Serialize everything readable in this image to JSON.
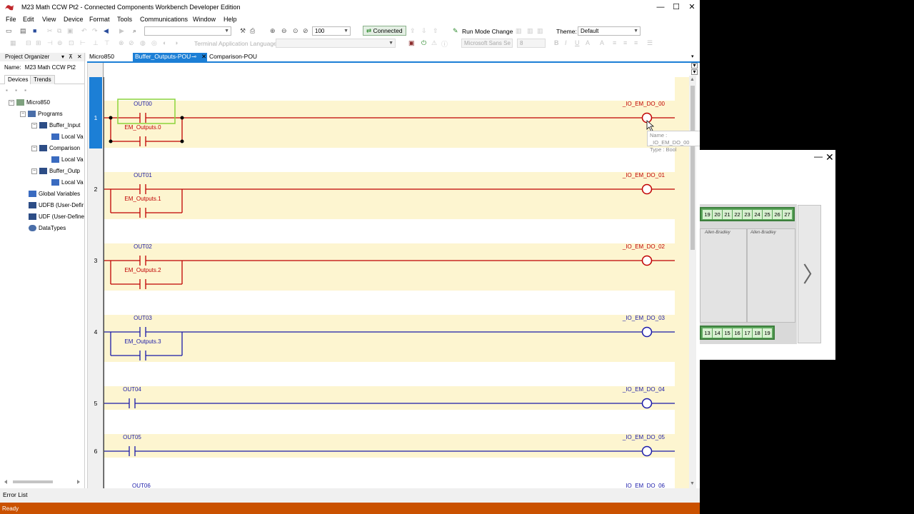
{
  "window": {
    "title": "M23 Math CCW Pt2 - Connected Components Workbench Developer Edition",
    "min": "—",
    "max": "☐",
    "close": "✕"
  },
  "menu": [
    "File",
    "Edit",
    "View",
    "Device",
    "Format",
    "Tools",
    "Communications",
    "Window",
    "Help"
  ],
  "toolbar": {
    "zoom": "100",
    "connected": "Connected",
    "run_mode": "Run Mode Change",
    "theme_label": "Theme:",
    "theme_value": "Default",
    "terminal_label": "Terminal Application Language:",
    "font_name": "Microsoft Sans Se",
    "font_size": "8"
  },
  "project_organizer": {
    "title": "Project Organizer",
    "pin": "⊼",
    "close": "✕",
    "name_label": "Name:",
    "name_value": "M23 Math CCW Pt2",
    "tabs": [
      "Devices",
      "Trends"
    ],
    "tree": [
      {
        "label": "Micro850",
        "icon": "controller-icon"
      },
      {
        "label": "Programs",
        "icon": "programs-icon"
      },
      {
        "label": "Buffer_Input",
        "icon": "program-icon"
      },
      {
        "label": "Local Va",
        "icon": "variables-icon"
      },
      {
        "label": "Comparison",
        "icon": "program-icon"
      },
      {
        "label": "Local Va",
        "icon": "variables-icon"
      },
      {
        "label": "Buffer_Outp",
        "icon": "program-icon"
      },
      {
        "label": "Local Va",
        "icon": "variables-icon"
      },
      {
        "label": "Global Variables",
        "icon": "variables-icon"
      },
      {
        "label": "UDFB (User-Defir",
        "icon": "udfb-icon"
      },
      {
        "label": "UDF (User-Define",
        "icon": "udf-icon"
      },
      {
        "label": "DataTypes",
        "icon": "datatypes-icon"
      }
    ]
  },
  "doc_tabs": [
    {
      "label": "Micro850"
    },
    {
      "label": "Buffer_Outputs-POU",
      "pin": "⊸",
      "close": "✕"
    },
    {
      "label": "Comparison-POU"
    }
  ],
  "rungs": [
    {
      "num": "1",
      "contact": "OUT00",
      "branch": "EM_Outputs.0",
      "coil": "_IO_EM_DO_00",
      "has_branch": true,
      "color": "#c00000",
      "highlight": true
    },
    {
      "num": "2",
      "contact": "OUT01",
      "branch": "EM_Outputs.1",
      "coil": "_IO_EM_DO_01",
      "has_branch": true,
      "color": "#c00000",
      "highlight": true
    },
    {
      "num": "3",
      "contact": "OUT02",
      "branch": "EM_Outputs.2",
      "coil": "_IO_EM_DO_02",
      "has_branch": true,
      "color": "#c00000",
      "highlight": true
    },
    {
      "num": "4",
      "contact": "OUT03",
      "branch": "EM_Outputs.3",
      "coil": "_IO_EM_DO_03",
      "has_branch": true,
      "color": "#1a1aa8",
      "highlight": true
    },
    {
      "num": "5",
      "contact": "OUT04",
      "branch": "",
      "coil": "_IO_EM_DO_04",
      "has_branch": false,
      "color": "#1a1aa8",
      "highlight": true
    },
    {
      "num": "6",
      "contact": "OUT05",
      "branch": "",
      "coil": "_IO_EM_DO_05",
      "has_branch": false,
      "color": "#1a1aa8",
      "highlight": true
    },
    {
      "num": "",
      "contact": "OUT06",
      "branch": "",
      "coil": "_IO_EM_DO_06",
      "has_branch": false,
      "color": "#1a1aa8",
      "highlight": false
    }
  ],
  "tooltip": {
    "name": "Name : _IO_EM_DO_00",
    "type": "Type : Bool"
  },
  "error_list": "Error List",
  "status": "Ready",
  "popup": {
    "close": "✕",
    "min": "—",
    "top_terminals": [
      "19",
      "20",
      "21",
      "22",
      "23",
      "24",
      "25",
      "26",
      "27"
    ],
    "bottom_terminals": [
      "13",
      "14",
      "15",
      "16",
      "17",
      "18",
      "19"
    ],
    "brand": "Allen-Bradley",
    "next": "〉"
  },
  "colors": {
    "accent": "#1c7fd6",
    "energized": "#c00000",
    "deenergized": "#1a1aa8",
    "rung_bg": "#fdf5d0",
    "status_bar": "#ca5100"
  }
}
